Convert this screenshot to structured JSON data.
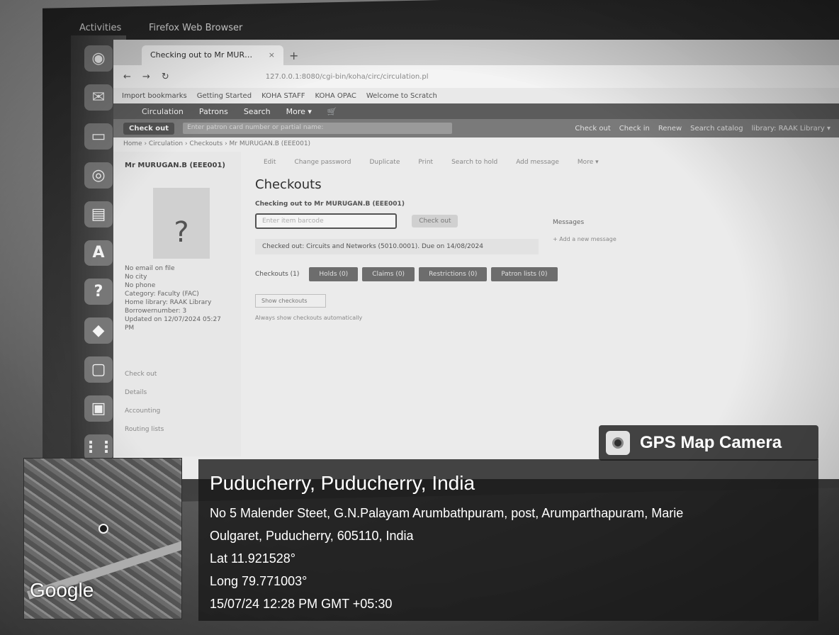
{
  "os": {
    "activities": "Activities",
    "app_name": "Firefox Web Browser"
  },
  "browser": {
    "tab_title": "Checking out to Mr MUR…",
    "tab_close": "×",
    "new_tab": "+",
    "url": "127.0.0.1:8080/cgi-bin/koha/circ/circulation.pl",
    "bookmarks": [
      "Import bookmarks",
      "Getting Started",
      "KOHA STAFF",
      "KOHA OPAC",
      "Welcome to Scratch"
    ]
  },
  "koha": {
    "nav": [
      "Circulation",
      "Patrons",
      "Search",
      "More ▾"
    ],
    "checkout_label": "Check out",
    "checkout_placeholder": "Enter patron card number or partial name:",
    "right_links": [
      "Check out",
      "Check in",
      "Renew",
      "Search catalog"
    ],
    "library": "library: RAAK Library ▾",
    "breadcrumb": "Home › Circulation › Checkouts › Mr MURUGAN.B (EEE001)",
    "patron": {
      "name": "Mr MURUGAN.B (EEE001)",
      "photo_placeholder": "?",
      "info": [
        "No email on file",
        "No city",
        "No phone",
        "Category: Faculty (FAC)",
        "Home library: RAAK Library",
        "Borrowernumber: 3",
        "Updated on 12/07/2024 05:27 PM"
      ],
      "menu": [
        "Check out",
        "Details",
        "Accounting",
        "Routing lists"
      ]
    },
    "toolbar": [
      "Edit",
      "Change password",
      "Duplicate",
      "Print",
      "Search to hold",
      "Add message",
      "More ▾"
    ],
    "page_title": "Checkouts",
    "checking_out_to": "Checking out to Mr MURUGAN.B (EEE001)",
    "barcode_placeholder": "Enter item barcode",
    "checkout_button": "Check out",
    "checked_out_msg": "Checked out: Circuits and Networks (5010.0001). Due on 14/08/2024",
    "messages_title": "Messages",
    "new_message": "+ Add a new message",
    "tabs_label": "Checkouts (1)",
    "tabs": [
      "Holds (0)",
      "Claims (0)",
      "Restrictions (0)",
      "Patron lists (0)"
    ],
    "show_checkouts": "Show checkouts",
    "always_show": "Always show checkouts automatically"
  },
  "gps": {
    "badge": "GPS Map Camera",
    "location": "Puducherry, Puducherry, India",
    "address_line1": "No 5 Malender Steet, G.N.Palayam Arumbathpuram, post, Arumparthapuram, Marie",
    "address_line2": "Oulgaret, Puducherry, 605110, India",
    "lat": "Lat 11.921528°",
    "long": "Long 79.771003°",
    "datetime": "15/07/24 12:28 PM GMT +05:30",
    "map_logo": "Google"
  }
}
